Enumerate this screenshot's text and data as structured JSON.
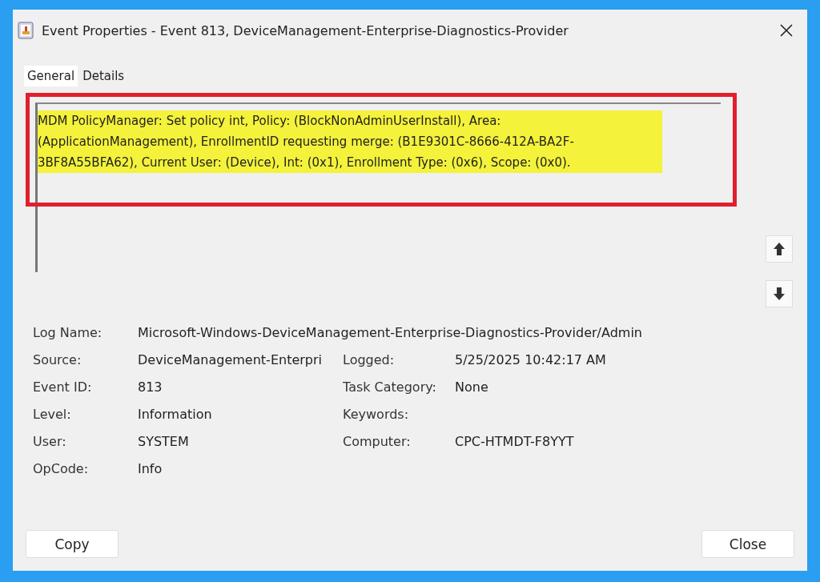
{
  "window": {
    "title": "Event Properties - Event 813, DeviceManagement-Enterprise-Diagnostics-Provider"
  },
  "tabs": [
    {
      "label": "General",
      "selected": true
    },
    {
      "label": "Details",
      "selected": false
    }
  ],
  "message": {
    "text": "MDM PolicyManager: Set policy int, Policy: (BlockNonAdminUserInstall), Area: (ApplicationManagement), EnrollmentID requesting merge: (B1E9301C-8666-412A-BA2F-3BF8A55BFA62), Current User: (Device), Int: (0x1), Enrollment Type: (0x6), Scope: (0x0).",
    "highlighted": true,
    "annotated": true
  },
  "log_name": {
    "label": "Log Name:",
    "value": "Microsoft-Windows-DeviceManagement-Enterprise-Diagnostics-Provider/Admin"
  },
  "fields": [
    {
      "label": "Source:",
      "value": "DeviceManagement-Enterpri"
    },
    {
      "label": "Logged:",
      "value": "5/25/2025 10:42:17 AM"
    },
    {
      "label": "Event ID:",
      "value": "813"
    },
    {
      "label": "Task Category:",
      "value": "None"
    },
    {
      "label": "Level:",
      "value": "Information"
    },
    {
      "label": "Keywords:"
    },
    {
      "label": "User:",
      "value": "SYSTEM"
    },
    {
      "label": "Computer:",
      "value": "CPC-HTMDT-F8YYT"
    },
    {
      "label": "OpCode:",
      "value": "Info"
    }
  ],
  "buttons": [
    "Copy",
    "Close"
  ]
}
